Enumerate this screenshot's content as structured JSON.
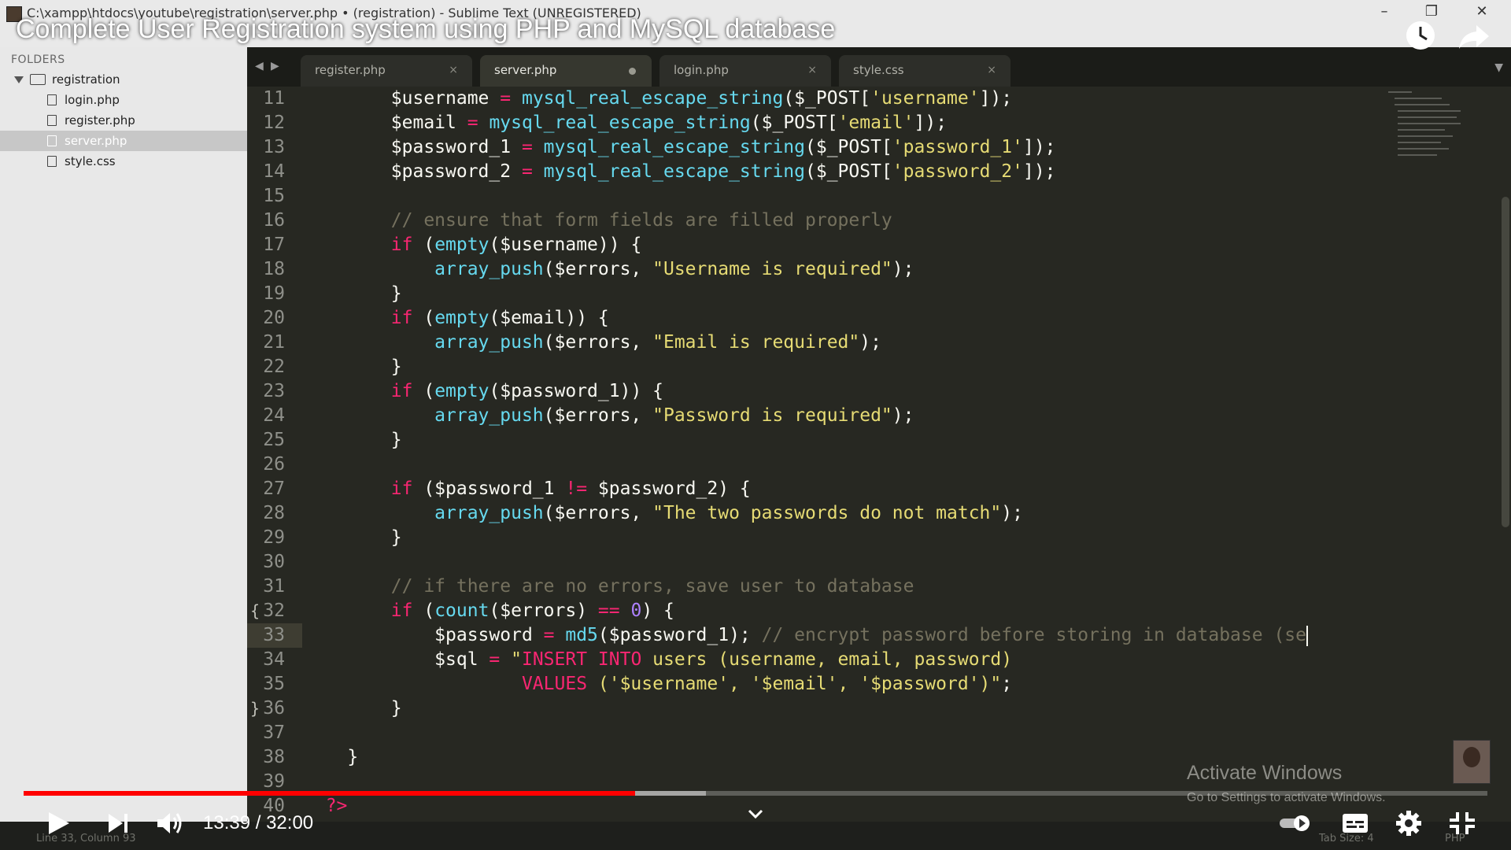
{
  "window": {
    "title": "C:\\xampp\\htdocs\\youtube\\registration\\server.php • (registration) - Sublime Text (UNREGISTERED)",
    "minimize": "–",
    "restore": "❐",
    "close": "✕"
  },
  "video": {
    "title": "Complete User Registration system using PHP and MySQL database",
    "current_time": "13:39",
    "separator": " / ",
    "duration": "32:00",
    "progress_played": 0.418,
    "progress_buffered": 0.466
  },
  "sidebar": {
    "folders_label": "FOLDERS",
    "root_folder": "registration",
    "files": [
      {
        "label": "login.php"
      },
      {
        "label": "register.php"
      },
      {
        "label": "server.php"
      },
      {
        "label": "style.css"
      }
    ]
  },
  "tabs": [
    {
      "label": "register.php",
      "close": "×"
    },
    {
      "label": "server.php",
      "close": ""
    },
    {
      "label": "login.php",
      "close": "×"
    },
    {
      "label": "style.css",
      "close": "×"
    }
  ],
  "editor": {
    "line_numbers": [
      "11",
      "12",
      "13",
      "14",
      "15",
      "16",
      "17",
      "18",
      "19",
      "20",
      "21",
      "22",
      "23",
      "24",
      "25",
      "26",
      "27",
      "28",
      "29",
      "30",
      "31",
      "32",
      "33",
      "34",
      "35",
      "36",
      "37",
      "38",
      "39",
      "40"
    ],
    "current_line": "33"
  },
  "watermark": {
    "line1": "Activate Windows",
    "line2": "Go to Settings to activate Windows."
  },
  "statusbar": {
    "position": "Line 33, Column 93",
    "tab_size": "Tab Size: 4",
    "syntax": "PHP"
  },
  "colors": {
    "keyword": "#f92672",
    "function": "#66d9ef",
    "string": "#e6db74",
    "comment": "#75715e",
    "number": "#ae81ff",
    "progress": "#ff0000"
  }
}
